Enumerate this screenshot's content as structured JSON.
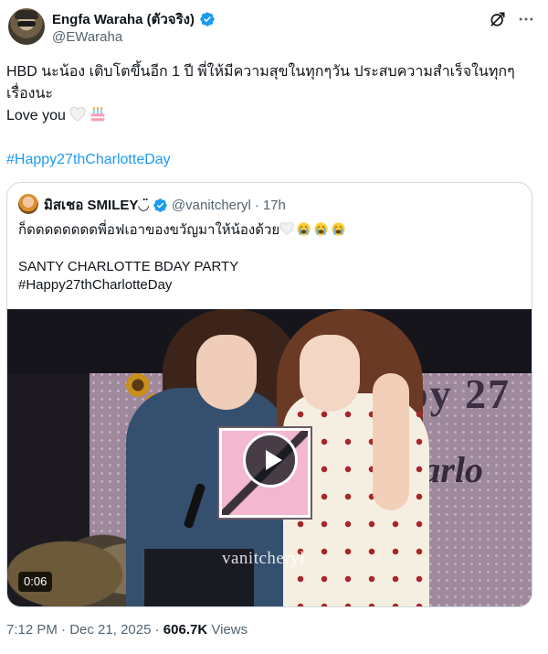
{
  "author": {
    "display_name": "Engfa Waraha (ตัวจริง)",
    "handle": "@EWaraha",
    "verified": true
  },
  "tweet": {
    "lines": [
      "HBD นะน้อง เติบโตขึ้นอีก 1 ปี พี่ให้มีความสุขในทุกๆวัน ประสบความสำเร็จในทุกๆ",
      "เรื่องนะ",
      "Love you"
    ],
    "hashtag": "#Happy27thCharlotteDay",
    "emojis": [
      "white-heart",
      "birthday-cake"
    ]
  },
  "quoted": {
    "display_name": "มิสเชอ SMILEY◡̈",
    "handle": "@vanitcheryl",
    "separator": "·",
    "time": "17h",
    "verified": true,
    "lines": [
      "ก็ดดดดดดดดพี่อฟเอาของขวัญมาให้น้องด้วย",
      "SANTY CHARLOTTE BDAY PARTY",
      "#Happy27thCharlotteDay"
    ],
    "video": {
      "duration": "0:06",
      "watermark": "vanitcheryl",
      "backdrop_text_1": "py 27",
      "backdrop_text_2": "harlo"
    }
  },
  "footer": {
    "time": "7:12 PM",
    "dot": "·",
    "date": "Dec 21, 2025",
    "views_count": "606.7K",
    "views_label": "Views"
  },
  "colors": {
    "text": "#0f1419",
    "secondary": "#536471",
    "link": "#1d9bf0",
    "border": "#cfd9de"
  }
}
